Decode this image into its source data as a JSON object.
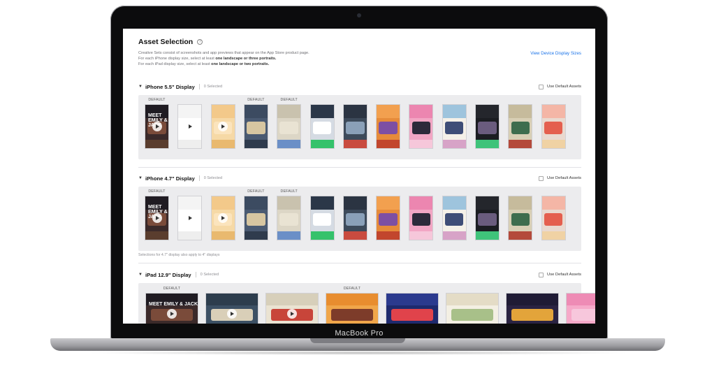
{
  "bezel_label": "MacBook Pro",
  "page": {
    "title": "Asset Selection",
    "info_icon": "info-circle-icon",
    "desc_line1": "Creative Sets consist of screenshots and app previews that appear on the App Store product page.",
    "desc_line2_prefix": "For each iPhone display size, select at least ",
    "desc_line2_bold": "one landscape or three portraits.",
    "desc_line3_prefix": "For each iPad display size, select at least ",
    "desc_line3_bold": "one landscape or two portraits.",
    "view_link": "View Device Display Sizes"
  },
  "sections": [
    {
      "title": "iPhone 5.5\" Display",
      "selected": "0 Selected",
      "default_assets_label": "Use Default Assets",
      "default_badge": "DEFAULT"
    },
    {
      "title": "iPhone 4.7\" Display",
      "selected": "0 Selected",
      "default_assets_label": "Use Default Assets",
      "default_badge": "DEFAULT",
      "footnote": "Selections for 4.7\" display also apply to 4\" displays"
    },
    {
      "title": "iPad 12.9\" Display",
      "selected": "0 Selected",
      "default_assets_label": "Use Default Assets",
      "default_badge": "DEFAULT"
    }
  ],
  "thumb_text": "MEET EMILY & JACK",
  "colors": {
    "accent": "#1a73e8",
    "tray": "#ececee",
    "bezel": "#0c0c0d"
  },
  "phone_thumbs": [
    {
      "bg": "#3b2a2a",
      "c1": "#1f1b22",
      "c2": "#7a4b3a",
      "c3": "#5a3d2e",
      "default": true,
      "play": true,
      "text": true
    },
    {
      "bg": "#ffffff",
      "c1": "#f4f4f4",
      "c2": "#ffffff",
      "c3": "#eeeeee",
      "default": false,
      "play": true,
      "text": false
    },
    {
      "bg": "#f6d9a6",
      "c1": "#f3c98a",
      "c2": "#fbe4bd",
      "c3": "#e9b96f",
      "default": false,
      "play": true,
      "text": false
    },
    {
      "bg": "#4a5a72",
      "c1": "#3c4b61",
      "c2": "#d7c6a1",
      "c3": "#2f3b4d",
      "default": true,
      "play": false,
      "text": false
    },
    {
      "bg": "#dcd6c6",
      "c1": "#c9c2ae",
      "c2": "#e9e3d3",
      "c3": "#6b8fc7",
      "default": true,
      "play": false,
      "text": false
    },
    {
      "bg": "#d5dbe3",
      "c1": "#2b3748",
      "c2": "#ffffff",
      "c3": "#35c26b",
      "default": false,
      "play": false,
      "text": false
    },
    {
      "bg": "#3d4a5a",
      "c1": "#2b3442",
      "c2": "#8aa0b8",
      "c3": "#c94b3f",
      "default": false,
      "play": false,
      "text": false
    },
    {
      "bg": "#e68b3a",
      "c1": "#f2a04f",
      "c2": "#7d4fa3",
      "c3": "#c2462d",
      "default": false,
      "play": false,
      "text": false
    },
    {
      "bg": "#f2a6c4",
      "c1": "#ec86b0",
      "c2": "#2d2a3a",
      "c3": "#f6c7da",
      "default": false,
      "play": false,
      "text": false
    },
    {
      "bg": "#f4f0e8",
      "c1": "#9ec4dd",
      "c2": "#3e4d77",
      "c3": "#d7a3c7",
      "default": false,
      "play": false,
      "text": false
    },
    {
      "bg": "#1b1d22",
      "c1": "#24262c",
      "c2": "#6a5c7e",
      "c3": "#3fc37a",
      "default": false,
      "play": false,
      "text": false
    },
    {
      "bg": "#d8cfb5",
      "c1": "#c6bb9c",
      "c2": "#3e6d4e",
      "c3": "#b44a3b",
      "default": false,
      "play": false,
      "text": false
    },
    {
      "bg": "#e9d9cf",
      "c1": "#f4b6a6",
      "c2": "#e45f4e",
      "c3": "#f0d2a4",
      "default": false,
      "play": false,
      "text": false
    }
  ],
  "ipad_thumbs": [
    {
      "bg": "#3b2a2a",
      "c1": "#1f1b22",
      "c2": "#7a4b3a",
      "c3": "#5a3d2e",
      "default": true,
      "play": true,
      "text": true
    },
    {
      "bg": "#3c5064",
      "c1": "#2d3d4d",
      "c2": "#d9cfb8",
      "c3": "#1f2a36",
      "default": false,
      "play": true,
      "text": false
    },
    {
      "bg": "#eae3d2",
      "c1": "#d7cfba",
      "c2": "#c8453a",
      "c3": "#6e8cbf",
      "default": false,
      "play": true,
      "text": false
    },
    {
      "bg": "#f0a64a",
      "c1": "#e88d2f",
      "c2": "#7d3c2a",
      "c3": "#ffffff",
      "default": true,
      "play": false,
      "text": false
    },
    {
      "bg": "#1e2a6e",
      "c1": "#2b3a8e",
      "c2": "#e0434b",
      "c3": "#1a1f3d",
      "default": false,
      "play": false,
      "text": false
    },
    {
      "bg": "#f3efe3",
      "c1": "#e4dcc6",
      "c2": "#a8c089",
      "c3": "#f1c96a",
      "default": false,
      "play": false,
      "text": false
    },
    {
      "bg": "#2a2342",
      "c1": "#1f1b35",
      "c2": "#e3a43a",
      "c3": "#c7463a",
      "default": false,
      "play": false,
      "text": false
    },
    {
      "bg": "#f6a9c9",
      "c1": "#ee8bb5",
      "c2": "#f7c7dc",
      "c3": "#e36a9c",
      "default": false,
      "play": false,
      "text": false
    }
  ]
}
